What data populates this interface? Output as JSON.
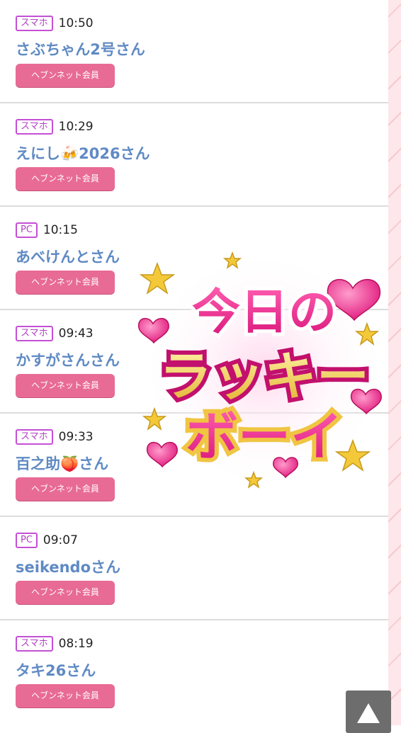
{
  "visits": [
    {
      "device": "スマホ",
      "time": "10:50",
      "name": "さぶちゃん2号さん",
      "member": "ヘブンネット会員"
    },
    {
      "device": "スマホ",
      "time": "10:29",
      "name": "えにし🍻2026さん",
      "member": "ヘブンネット会員"
    },
    {
      "device": "PC",
      "time": "10:15",
      "name": "あべけんとさん",
      "member": "ヘブンネット会員"
    },
    {
      "device": "スマホ",
      "time": "09:43",
      "name": "かすがさんさん",
      "member": "ヘブンネット会員"
    },
    {
      "device": "スマホ",
      "time": "09:33",
      "name": "百之助🍑さん",
      "member": "ヘブンネット会員"
    },
    {
      "device": "PC",
      "time": "09:07",
      "name": "seikendoさん",
      "member": "ヘブンネット会員"
    },
    {
      "device": "スマホ",
      "time": "08:19",
      "name": "タキ26さん",
      "member": "ヘブンネット会員"
    }
  ],
  "lucky_banner": {
    "line1": "今日の",
    "line2": "ラッキー",
    "line3": "ボーイ"
  },
  "back_to_top_icon": "up-triangle-icon"
}
